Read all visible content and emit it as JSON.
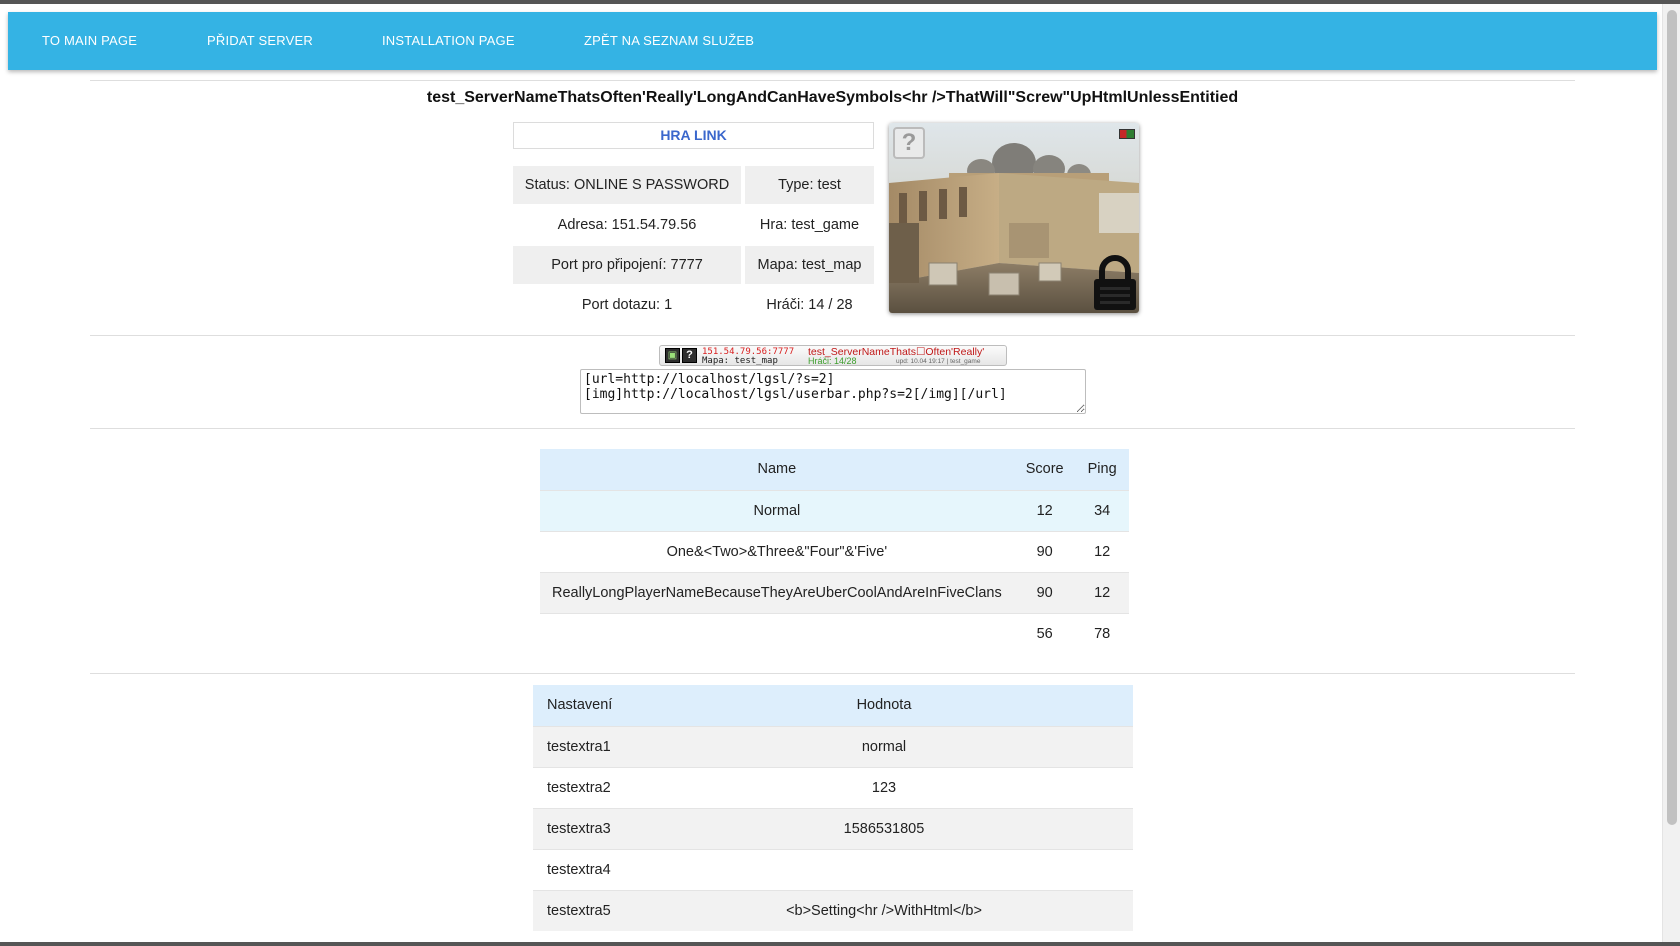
{
  "navbar": {
    "items": [
      {
        "label": "TO MAIN PAGE"
      },
      {
        "label": "PŘIDAT SERVER"
      },
      {
        "label": "INSTALLATION PAGE"
      },
      {
        "label": "ZPĚT NA SEZNAM SLUŽEB"
      }
    ]
  },
  "server": {
    "title": "test_ServerNameThatsOften'Really'LongAndCanHaveSymbols<hr />ThatWill\"Screw\"UpHtmlUnlessEntitied",
    "link_label": "HRA LINK",
    "status": "Status: ONLINE S PASSWORD",
    "type": "Type: test",
    "address": "Adresa: 151.54.79.56",
    "game": "Hra: test_game",
    "connect_port": "Port pro připojení: 7777",
    "map": "Mapa: test_map",
    "query_port": "Port dotazu: 1",
    "players": "Hráči: 14 / 28"
  },
  "userbar": {
    "address": "151.54.79.56:7777",
    "map": "Mapa: test_map",
    "name": "test_ServerNameThats☐Often'Really'",
    "players": "Hráči: 14/28",
    "updated": "upd: 10.04 19:17 | test_game",
    "bbcode": "[url=http://localhost/lgsl/?s=2]\n[img]http://localhost/lgsl/userbar.php?s=2[/img][/url]"
  },
  "players_table": {
    "headers": {
      "name": "Name",
      "score": "Score",
      "ping": "Ping"
    },
    "rows": [
      {
        "name": "Normal",
        "score": "12",
        "ping": "34"
      },
      {
        "name": "One&<Two>&Three&\"Four\"&'Five'",
        "score": "90",
        "ping": "12"
      },
      {
        "name": "ReallyLongPlayerNameBecauseTheyAreUberCoolAndAreInFiveClans",
        "score": "90",
        "ping": "12"
      },
      {
        "name": "",
        "score": "56",
        "ping": "78"
      }
    ]
  },
  "settings_table": {
    "headers": {
      "key": "Nastavení",
      "value": "Hodnota"
    },
    "rows": [
      {
        "key": "testextra1",
        "value": "normal"
      },
      {
        "key": "testextra2",
        "value": "123"
      },
      {
        "key": "testextra3",
        "value": "1586531805"
      },
      {
        "key": "testextra4",
        "value": ""
      },
      {
        "key": "testextra5",
        "value": "<b>Setting<hr />WithHtml</b>"
      }
    ]
  },
  "icons": {
    "unknown_game": "question-mark-icon",
    "country_flag": "flag-icon",
    "password": "lock-icon"
  },
  "colors": {
    "navbar": "#34b3e4",
    "link": "#3a67cc",
    "table_header": "#ddeefc",
    "row_highlight": "#e6f6fc"
  }
}
